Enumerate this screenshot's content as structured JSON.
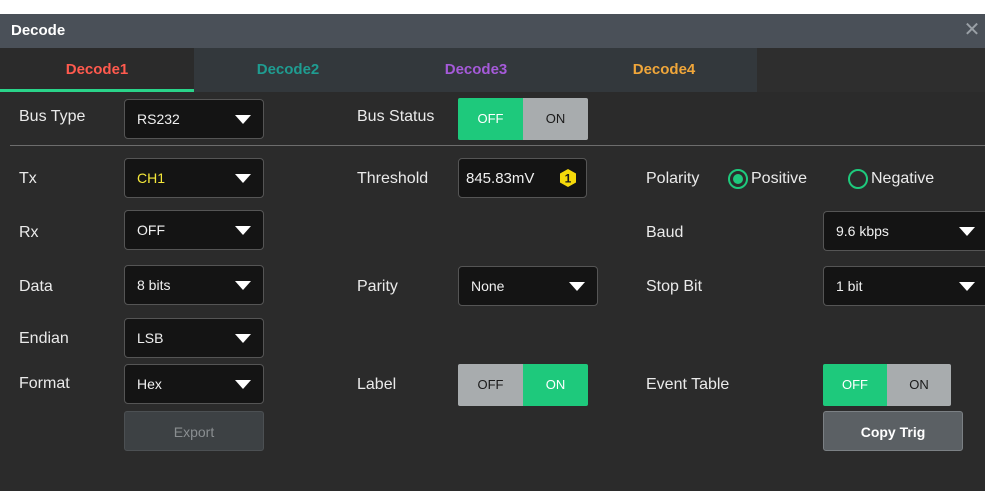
{
  "window": {
    "title": "Decode",
    "close_icon": "close-icon"
  },
  "tabs": [
    {
      "label": "Decode1",
      "color": "#ff5a4e",
      "active": true
    },
    {
      "label": "Decode2",
      "color": "#1f9c91",
      "active": false
    },
    {
      "label": "Decode3",
      "color": "#a55ad9",
      "active": false
    },
    {
      "label": "Decode4",
      "color": "#f0a63a",
      "active": false
    }
  ],
  "bus_type": {
    "label": "Bus Type",
    "value": "RS232"
  },
  "bus_status": {
    "label": "Bus Status",
    "off": "OFF",
    "on": "ON",
    "state": "OFF"
  },
  "tx": {
    "label": "Tx",
    "value": "CH1"
  },
  "threshold": {
    "label": "Threshold",
    "value": "845.83mV",
    "badge": "1"
  },
  "polarity": {
    "label": "Polarity",
    "positive": "Positive",
    "negative": "Negative",
    "selected": "Positive"
  },
  "rx": {
    "label": "Rx",
    "value": "OFF"
  },
  "baud": {
    "label": "Baud",
    "value": "9.6  kbps"
  },
  "data_bits": {
    "label": "Data",
    "value": "8 bits"
  },
  "parity": {
    "label": "Parity",
    "value": "None"
  },
  "stop_bit": {
    "label": "Stop Bit",
    "value": "1 bit"
  },
  "endian": {
    "label": "Endian",
    "value": "LSB"
  },
  "format": {
    "label": "Format",
    "value": "Hex"
  },
  "label_toggle": {
    "label": "Label",
    "off": "OFF",
    "on": "ON",
    "state": "ON"
  },
  "event_table": {
    "label": "Event Table",
    "off": "OFF",
    "on": "ON",
    "state": "OFF"
  },
  "buttons": {
    "export": "Export",
    "copy_trig": "Copy Trig"
  },
  "colors": {
    "accent_green": "#1ec97c",
    "threshold_badge": "#f5d90a"
  }
}
